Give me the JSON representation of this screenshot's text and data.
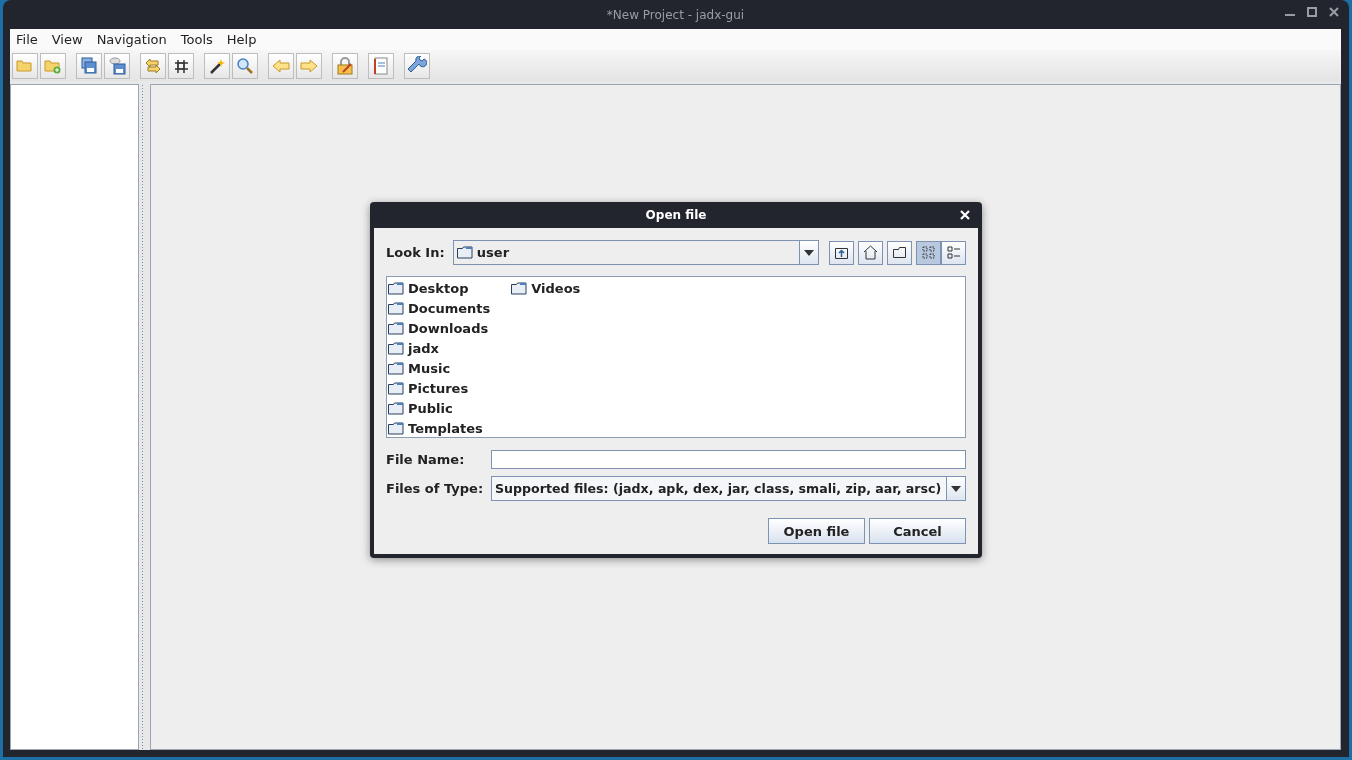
{
  "window": {
    "title": "*New Project - jadx-gui"
  },
  "menu": [
    "File",
    "View",
    "Navigation",
    "Tools",
    "Help"
  ],
  "dialog": {
    "title": "Open file",
    "look_in_label": "Look In:",
    "look_in_value": "user",
    "view_buttons": [
      {
        "kind": "list",
        "selected": true
      },
      {
        "kind": "details",
        "selected": false
      }
    ],
    "files": [
      "Desktop",
      "Documents",
      "Downloads",
      "jadx",
      "Music",
      "Pictures",
      "Public",
      "Templates",
      "Videos"
    ],
    "file_name_label": "File Name:",
    "file_type_label": "Files of Type:",
    "file_type_value": "Supported files: (jadx, apk, dex, jar, class, smali, zip, aar, arsc)",
    "buttons": [
      "Open file",
      "Cancel"
    ]
  }
}
